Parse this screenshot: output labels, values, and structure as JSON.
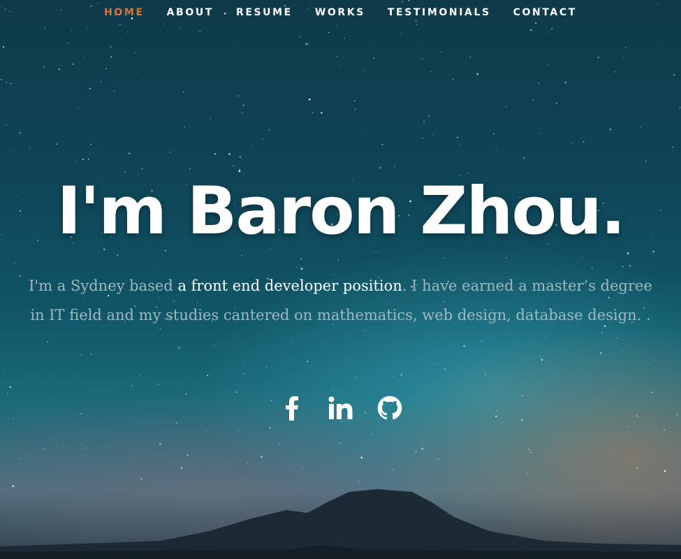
{
  "nav": {
    "items": [
      {
        "label": "HOME",
        "active": true
      },
      {
        "label": "ABOUT",
        "active": false
      },
      {
        "label": "RESUME",
        "active": false
      },
      {
        "label": "WORKS",
        "active": false
      },
      {
        "label": "TESTIMONIALS",
        "active": false
      },
      {
        "label": "CONTACT",
        "active": false
      }
    ],
    "active_color": "#d9743c",
    "text_color": "#ffffff"
  },
  "hero": {
    "headline": "I'm Baron Zhou.",
    "intro_before": "I'm a Sydney based ",
    "intro_highlight": "a front end developer position",
    "intro_after": ". I have earned a master’s degree in IT field and my studies cantered on mathematics, web design, database design. .",
    "intro_color": "#a3b8bd"
  },
  "social": [
    {
      "icon": "facebook-icon"
    },
    {
      "icon": "linkedin-icon"
    },
    {
      "icon": "github-icon"
    }
  ]
}
